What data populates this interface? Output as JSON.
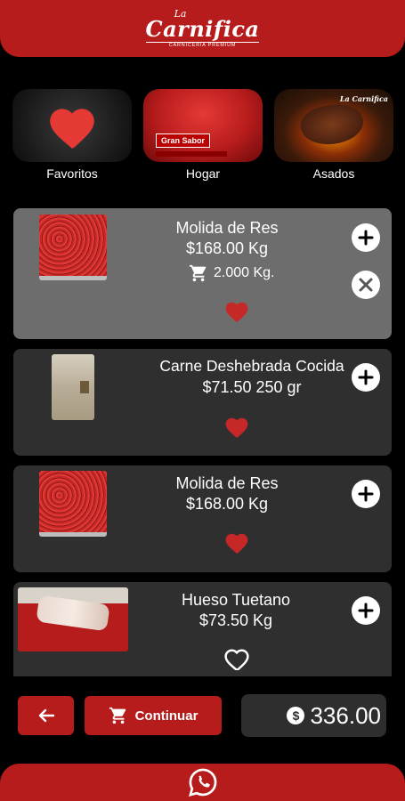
{
  "header": {
    "logo_small": "La",
    "logo_main": "Carnifica",
    "logo_sub": "CARNICERIA PREMIUM"
  },
  "categories": [
    {
      "label": "Favoritos",
      "icon": "heart-icon"
    },
    {
      "label": "Hogar",
      "banner": "Gran Sabor"
    },
    {
      "label": "Asados",
      "brand": "La Carnifica"
    }
  ],
  "products": [
    {
      "name": "Molida de Res",
      "price": "$168.00 Kg",
      "qty": "2.000 Kg.",
      "favorite": true,
      "in_cart": true
    },
    {
      "name": "Carne Deshebrada Cocida",
      "price": "$71.50 250 gr",
      "favorite": true,
      "in_cart": false
    },
    {
      "name": "Molida de Res",
      "price": "$168.00 Kg",
      "favorite": true,
      "in_cart": false
    },
    {
      "name": "Hueso Tuetano",
      "price": "$73.50 Kg",
      "favorite": false,
      "in_cart": false
    }
  ],
  "actions": {
    "back_icon": "arrow-left-icon",
    "continue_label": "Continuar",
    "total": "336.00"
  },
  "footer": {
    "icon": "whatsapp-icon"
  },
  "colors": {
    "brand_red": "#b71c1c",
    "heart_red": "#c62828",
    "card": "#2f2f2f",
    "card_active": "#6d6d6d"
  }
}
